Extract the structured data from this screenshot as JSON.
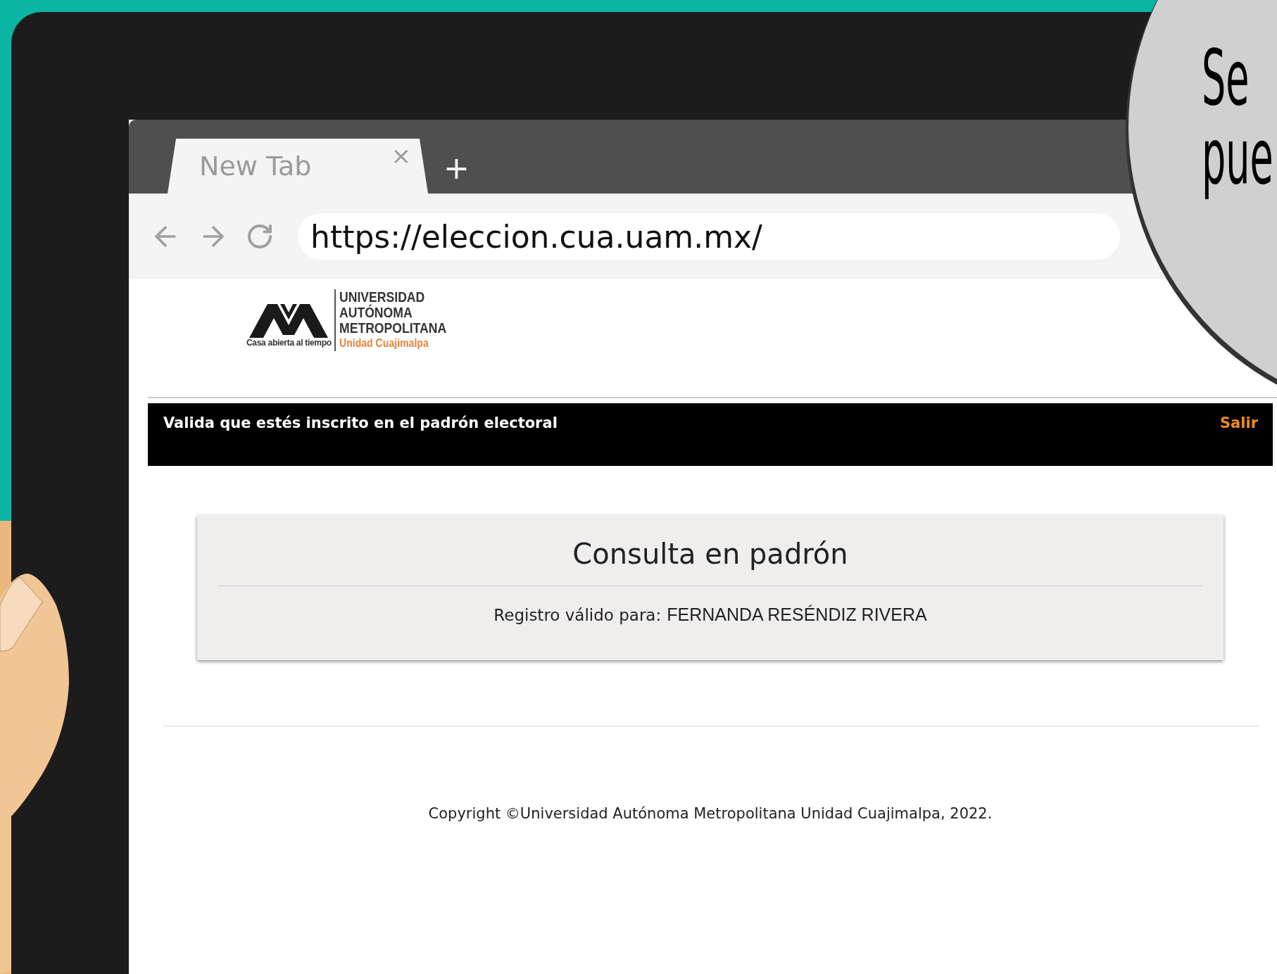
{
  "browser": {
    "tab": {
      "title": "New Tab",
      "close": "×"
    },
    "new_tab": "+",
    "address": "https://eleccion.cua.uam.mx/"
  },
  "logo": {
    "tagline": "Casa abierta al tiempo",
    "lines": [
      "UNIVERSIDAD",
      "AUTÓNOMA",
      "METROPOLITANA"
    ],
    "unit": "Unidad Cuajimalpa"
  },
  "nav_bar": {
    "title": "Valida que estés inscrito en el padrón electoral",
    "action": "Salir"
  },
  "card": {
    "title": "Consulta en padrón",
    "label": "Registro válido para:",
    "name": "FERNANDA RESÉNDIZ RIVERA"
  },
  "footer": "Copyright ©Universidad Autónoma Metropolitana Unidad Cuajimalpa, 2022.",
  "bubble": {
    "lines": [
      "Se",
      "pue"
    ]
  }
}
